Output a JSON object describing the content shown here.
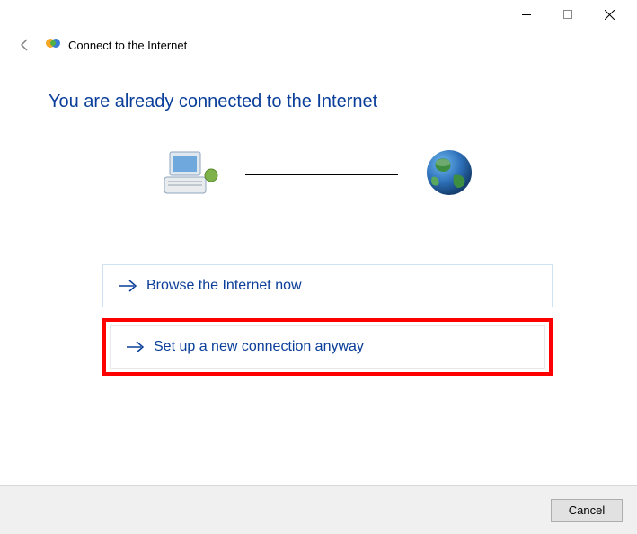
{
  "window": {
    "title": "Connect to the Internet"
  },
  "content": {
    "heading": "You are already connected to the Internet",
    "options": {
      "browse": "Browse the Internet now",
      "new_connection": "Set up a new connection anyway"
    }
  },
  "footer": {
    "cancel": "Cancel"
  }
}
